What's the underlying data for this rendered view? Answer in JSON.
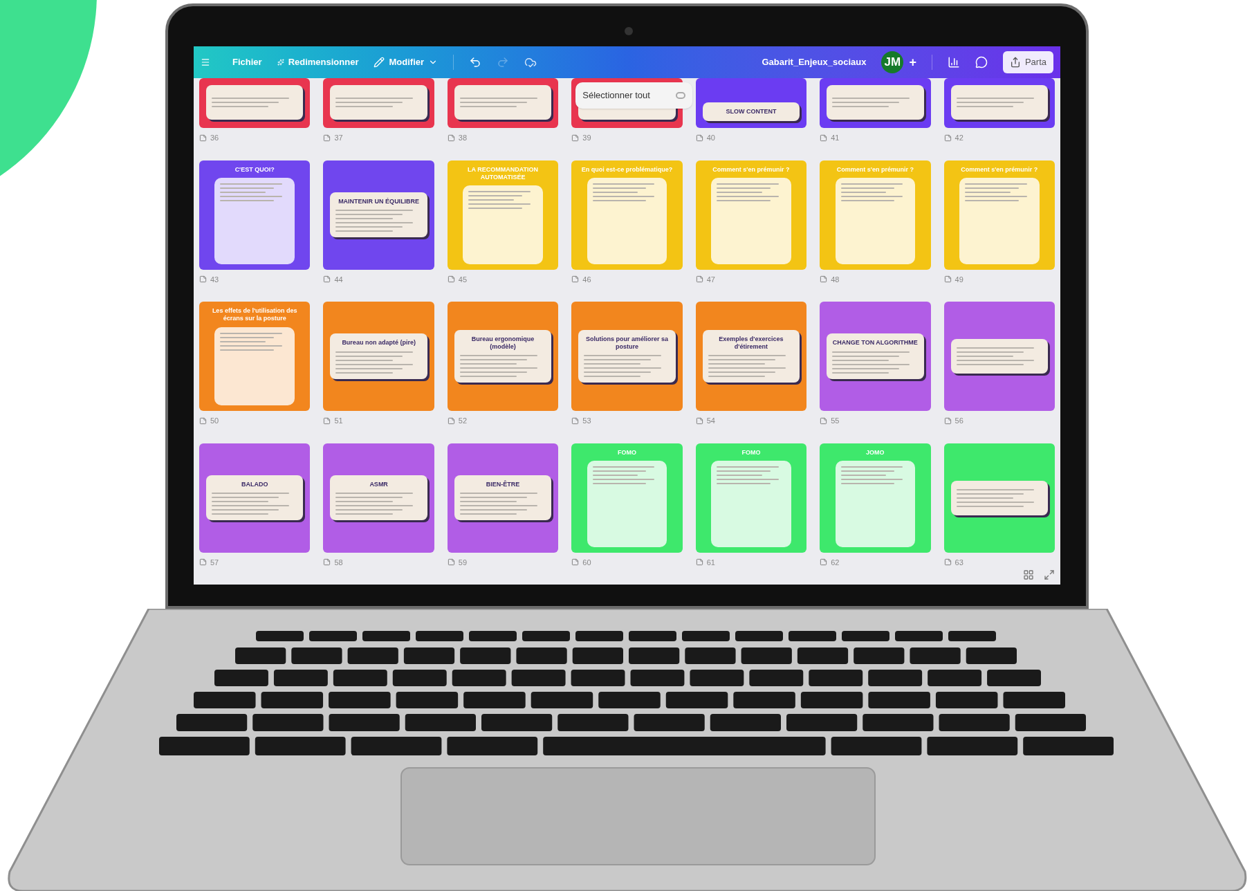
{
  "toolbar": {
    "menu": [
      "Fichier",
      "Redimensionner",
      "Modifier"
    ],
    "redo_disabled": true,
    "document_title": "Gabarit_Enjeux_sociaux",
    "avatar": "JM",
    "add": "+",
    "share": "Parta"
  },
  "pages": [
    {
      "number": "36",
      "color": "#e8354f",
      "kind": "plain"
    },
    {
      "number": "37",
      "color": "#e8354f",
      "kind": "plain"
    },
    {
      "number": "38",
      "color": "#e8354f",
      "kind": "plain"
    },
    {
      "number": "39",
      "color": "#e8354f",
      "kind": "plain",
      "popup": "Sélectionner tout"
    },
    {
      "number": "40",
      "color": "#6b3cf2",
      "kind": "card",
      "title": "SLOW CONTENT"
    },
    {
      "number": "41",
      "color": "#6b3cf2",
      "kind": "plain"
    },
    {
      "number": "42",
      "color": "#6b3cf2",
      "kind": "plain"
    },
    {
      "number": "43",
      "color": "#7046ee",
      "kind": "banner",
      "title": "C'EST QUOI?"
    },
    {
      "number": "44",
      "color": "#7046ee",
      "kind": "card",
      "title": "MAINTENIR UN ÉQUILIBRE"
    },
    {
      "number": "45",
      "color": "#f3c414",
      "kind": "banner",
      "title": "LA RECOMMANDATION AUTOMATISÉE"
    },
    {
      "number": "46",
      "color": "#f3c414",
      "kind": "banner",
      "title": "En quoi est-ce problématique?"
    },
    {
      "number": "47",
      "color": "#f3c414",
      "kind": "banner",
      "title": "Comment s'en prémunir ?"
    },
    {
      "number": "48",
      "color": "#f3c414",
      "kind": "banner",
      "title": "Comment s'en prémunir ?"
    },
    {
      "number": "49",
      "color": "#f3c414",
      "kind": "banner",
      "title": "Comment s'en prémunir ?"
    },
    {
      "number": "50",
      "color": "#f2861e",
      "kind": "banner",
      "title": "Les effets de l'utilisation des écrans sur la posture"
    },
    {
      "number": "51",
      "color": "#f2861e",
      "kind": "card",
      "title": "Bureau non adapté (pire)"
    },
    {
      "number": "52",
      "color": "#f2861e",
      "kind": "card",
      "title": "Bureau ergonomique (modèle)"
    },
    {
      "number": "53",
      "color": "#f2861e",
      "kind": "card",
      "title": "Solutions pour améliorer sa posture"
    },
    {
      "number": "54",
      "color": "#f2861e",
      "kind": "card",
      "title": "Exemples d'exercices d'étirement"
    },
    {
      "number": "55",
      "color": "#b15de6",
      "kind": "card",
      "title": "CHANGE TON ALGORITHME"
    },
    {
      "number": "56",
      "color": "#b15de6",
      "kind": "plain"
    },
    {
      "number": "57",
      "color": "#b15de6",
      "kind": "card",
      "title": "BALADO"
    },
    {
      "number": "58",
      "color": "#b15de6",
      "kind": "card",
      "title": "ASMR"
    },
    {
      "number": "59",
      "color": "#b15de6",
      "kind": "card",
      "title": "BIEN-ÊTRE"
    },
    {
      "number": "60",
      "color": "#3ee86c",
      "kind": "banner",
      "title": "FOMO"
    },
    {
      "number": "61",
      "color": "#3ee86c",
      "kind": "banner",
      "title": "FOMO"
    },
    {
      "number": "62",
      "color": "#3ee86c",
      "kind": "banner",
      "title": "JOMO"
    },
    {
      "number": "63",
      "color": "#3ee86c",
      "kind": "plain"
    }
  ]
}
